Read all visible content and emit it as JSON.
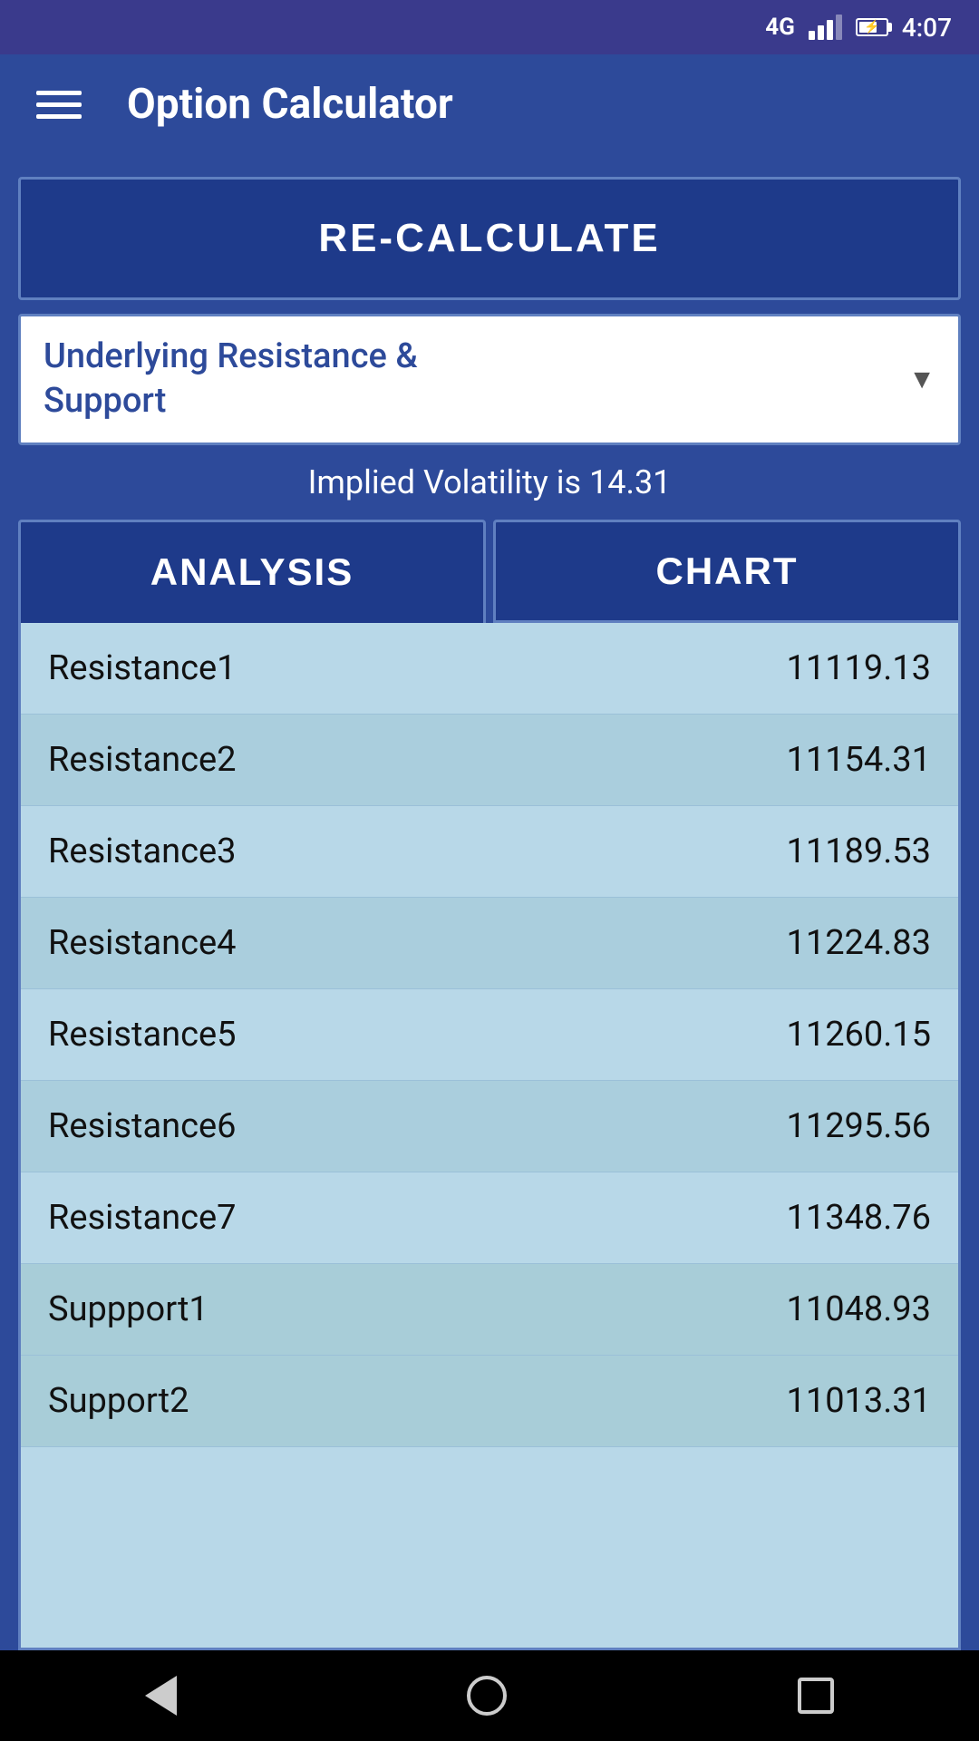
{
  "statusBar": {
    "network": "4G",
    "time": "4:07"
  },
  "appBar": {
    "menuIcon": "hamburger-icon",
    "title": "Option Calculator"
  },
  "recalculate": {
    "label": "RE-CALCULATE"
  },
  "dropdown": {
    "selectedText": "Underlying Resistance &\nSupport",
    "arrowIcon": "chevron-down-icon"
  },
  "volatility": {
    "label": "Implied Volatility is 14.31"
  },
  "tabs": [
    {
      "id": "analysis",
      "label": "ANALYSIS",
      "active": true
    },
    {
      "id": "chart",
      "label": "CHART",
      "active": false
    }
  ],
  "tableRows": [
    {
      "label": "Resistance1",
      "value": "11119.13",
      "type": "resistance"
    },
    {
      "label": "Resistance2",
      "value": "11154.31",
      "type": "resistance"
    },
    {
      "label": "Resistance3",
      "value": "11189.53",
      "type": "resistance"
    },
    {
      "label": "Resistance4",
      "value": "11224.83",
      "type": "resistance"
    },
    {
      "label": "Resistance5",
      "value": "11260.15",
      "type": "resistance"
    },
    {
      "label": "Resistance6",
      "value": "11295.56",
      "type": "resistance"
    },
    {
      "label": "Resistance7",
      "value": "11348.76",
      "type": "resistance"
    },
    {
      "label": "Suppport1",
      "value": "11048.93",
      "type": "support"
    },
    {
      "label": "Support2",
      "value": "11013.31",
      "type": "support"
    }
  ],
  "navBar": {
    "backIcon": "back-icon",
    "homeIcon": "home-icon",
    "recentIcon": "recent-apps-icon"
  }
}
